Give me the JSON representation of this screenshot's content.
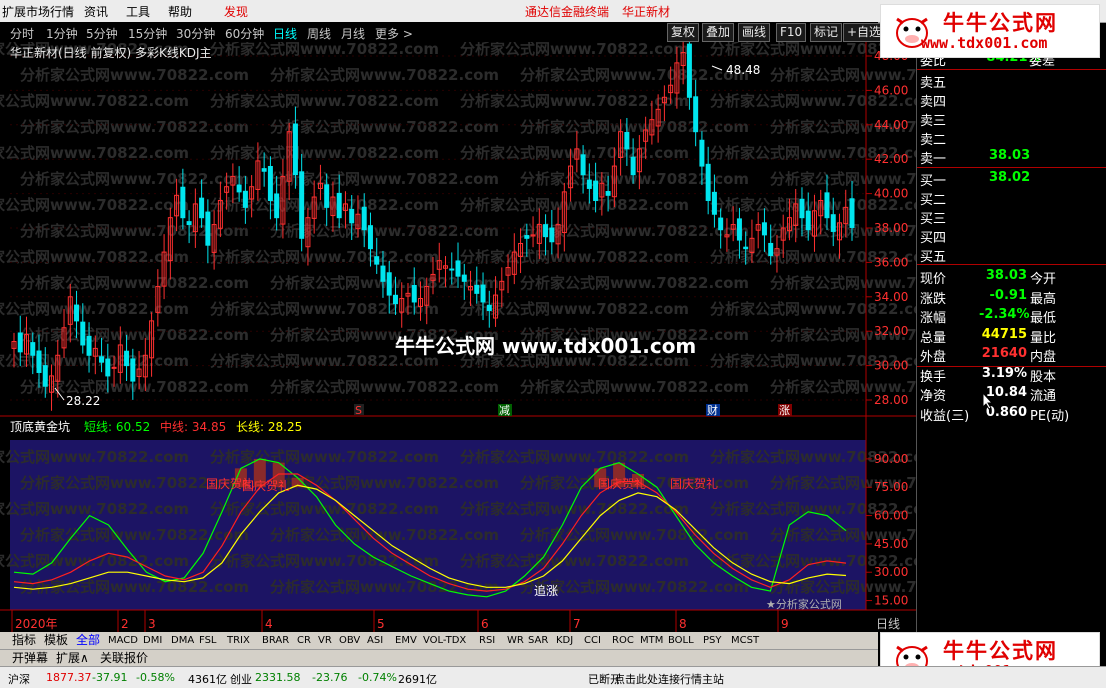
{
  "menu": {
    "items": [
      {
        "label": "扩展市场行情",
        "red": false
      },
      {
        "label": "资讯",
        "red": false
      },
      {
        "label": "工具",
        "red": false
      },
      {
        "label": "帮助",
        "red": false
      },
      {
        "label": "发现",
        "red": true
      }
    ],
    "center_title": "通达信金融终端",
    "center_stock": "华正新材"
  },
  "periods": [
    "分时",
    "1分钟",
    "5分钟",
    "15分钟",
    "30分钟",
    "60分钟",
    "日线",
    "周线",
    "月线",
    "更多 >"
  ],
  "active_period": "日线",
  "toolbar": [
    "复权",
    "叠加",
    "画线",
    "F10",
    "标记",
    "+自选"
  ],
  "chart_title": "华正新材(日线 前复权) 多彩K线KDJ主",
  "price_axis": [
    "48.00",
    "46.00",
    "44.00",
    "42.00",
    "40.00",
    "38.00",
    "36.00",
    "34.00",
    "32.00",
    "30.00",
    "28.00"
  ],
  "price_high_label": "48.48",
  "price_low_label": "28.22",
  "event_markers": [
    "S",
    "减",
    "财",
    "涨"
  ],
  "indicator": {
    "name": "顶底黄金坑",
    "short_label": "短线: 60.52",
    "mid_label": "中线: 34.85",
    "long_label": "长线: 28.25",
    "axis": [
      "90.00",
      "75.00",
      "60.00",
      "45.00",
      "30.00",
      "15.00"
    ],
    "annotations": [
      "国庆贺礼",
      "国庆贺礼",
      "国庆贺礼",
      "国庆贺礼"
    ],
    "signals": [
      "追涨"
    ],
    "watermark": "★分析家公式网"
  },
  "date_axis": [
    "2020年",
    "2",
    "3",
    "4",
    "5",
    "6",
    "7",
    "8",
    "9"
  ],
  "date_axis_end": "日线",
  "tabs": [
    "指标",
    "模板",
    "全部",
    "MACD",
    "DMI",
    "DMA",
    "FSL",
    "TRIX",
    "BRAR",
    "CR",
    "VR",
    "OBV",
    "ASI",
    "EMV",
    "VOL-TDX",
    "RSI",
    "WR",
    "SAR",
    "KDJ",
    "CCI",
    "ROC",
    "MTM",
    "BOLL",
    "PSY",
    "MCST"
  ],
  "active_tab": "全部",
  "tabs2": [
    "开弹幕",
    "扩展∧",
    "关联报价"
  ],
  "quote": {
    "weibi_label": "委比",
    "weibi_value": "-84.21%",
    "weicha_label": "委差",
    "sell": [
      "卖五",
      "卖四",
      "卖三",
      "卖二",
      "卖一"
    ],
    "sell1_price": "38.03",
    "buy": [
      "买一",
      "买二",
      "买三",
      "买四",
      "买五"
    ],
    "buy1_price": "38.02",
    "rows": [
      {
        "l": "现价",
        "v": "38.03",
        "c": "#00ff00",
        "r": "今开"
      },
      {
        "l": "涨跌",
        "v": "-0.91",
        "c": "#00ff00",
        "r": "最高"
      },
      {
        "l": "涨幅",
        "v": "-2.34%",
        "c": "#00ff00",
        "r": "最低"
      },
      {
        "l": "总量",
        "v": "44715",
        "c": "#ffff00",
        "r": "量比"
      },
      {
        "l": "外盘",
        "v": "21640",
        "c": "#ff3030",
        "r": "内盘"
      },
      {
        "l": "换手",
        "v": "3.19%",
        "c": "#ffffff",
        "r": "股本"
      },
      {
        "l": "净资",
        "v": "10.84",
        "c": "#ffffff",
        "r": "流通"
      },
      {
        "l": "收益(三)",
        "v": "0.860",
        "c": "#ffffff",
        "r": "PE(动)"
      }
    ]
  },
  "status": [
    {
      "t": "沪深",
      "c": "#000"
    },
    {
      "t": "1877.37",
      "c": "#e00000"
    },
    {
      "t": "-37.91",
      "c": "#008000"
    },
    {
      "t": "-0.58%",
      "c": "#008000"
    },
    {
      "t": "4361亿",
      "c": "#000"
    },
    {
      "t": "创业",
      "c": "#000"
    },
    {
      "t": "2331.58",
      "c": "#008000"
    },
    {
      "t": "-23.76",
      "c": "#008000"
    },
    {
      "t": "-0.74%",
      "c": "#008000"
    },
    {
      "t": "2691亿",
      "c": "#000"
    },
    {
      "t": "已断开",
      "c": "#000"
    },
    {
      "t": "点击此处连接行情主站",
      "c": "#000"
    }
  ],
  "logo_title": "牛牛公式网",
  "logo_url": "www.tdx001.com",
  "center_ad": "牛牛公式网 www.tdx001.com",
  "watermark_text": "分析家公式网www.70822.com",
  "colors": {
    "up": "#ff3030",
    "down": "#00e5ee",
    "short": "#00ff00",
    "mid": "#ff2020",
    "long": "#ffff00",
    "bg_indicator": "#1c1464"
  },
  "chart_data": [
    {
      "type": "candlestick",
      "title": "华正新材(日线 前复权) 多彩K线KDJ主",
      "ylim": [
        27,
        49
      ],
      "x_ticks": [
        "2020年",
        "2",
        "3",
        "4",
        "5",
        "6",
        "7",
        "8",
        "9"
      ],
      "close": [
        31.4,
        30.8,
        31.8,
        30.6,
        29.6,
        28.8,
        29.4,
        30.6,
        32.2,
        34.0,
        32.6,
        31.2,
        30.6,
        31.0,
        30.2,
        29.4,
        29.9,
        31.2,
        30.0,
        29.1,
        29.8,
        30.6,
        32.6,
        34.6,
        36.6,
        38.6,
        39.9,
        38.6,
        38.2,
        39.4,
        38.6,
        37.0,
        38.2,
        39.6,
        40.4,
        41.0,
        40.1,
        39.2,
        40.4,
        41.9,
        41.3,
        39.6,
        38.6,
        41.0,
        43.6,
        41.1,
        37.4,
        38.6,
        39.8,
        40.6,
        39.2,
        39.8,
        38.6,
        39.4,
        38.3,
        38.8,
        37.9,
        36.8,
        35.9,
        34.9,
        34.1,
        33.6,
        33.9,
        34.2,
        33.7,
        33.9,
        34.6,
        35.3,
        36.1,
        35.8,
        35.6,
        35.2,
        34.9,
        34.6,
        34.2,
        33.7,
        33.2,
        34.1,
        34.9,
        35.7,
        36.6,
        37.1,
        37.4,
        37.6,
        38.2,
        37.5,
        37.2,
        38.2,
        40.1,
        41.6,
        42.6,
        41.1,
        40.3,
        39.6,
        40.6,
        39.9,
        41.6,
        43.6,
        42.6,
        41.1,
        42.6,
        43.7,
        44.3,
        44.9,
        45.6,
        46.3,
        47.6,
        48.2,
        45.6,
        43.6,
        41.6,
        39.6,
        38.8,
        37.9,
        37.6,
        38.2,
        37.3,
        36.8,
        37.4,
        38.2,
        37.6,
        36.4,
        36.8,
        38.0,
        38.6,
        39.4,
        38.6,
        37.9,
        39.0,
        39.6,
        38.6,
        37.8,
        38.3,
        39.2,
        38.03
      ]
    },
    {
      "type": "line",
      "title": "顶底黄金坑",
      "ylim": [
        10,
        100
      ],
      "series": [
        {
          "name": "短线",
          "values": [
            30,
            29,
            35,
            48,
            60,
            55,
            42,
            30,
            25,
            27,
            40,
            62,
            85,
            90,
            88,
            80,
            70,
            55,
            45,
            38,
            33,
            28,
            24,
            20,
            18,
            17,
            20,
            28,
            38,
            55,
            75,
            85,
            88,
            82,
            75,
            60,
            45,
            35,
            28,
            22,
            20,
            55,
            62,
            60,
            52
          ]
        },
        {
          "name": "中线",
          "values": [
            25,
            24,
            26,
            30,
            36,
            40,
            38,
            33,
            28,
            26,
            30,
            44,
            62,
            75,
            82,
            82,
            76,
            68,
            58,
            48,
            40,
            34,
            28,
            24,
            21,
            20,
            21,
            25,
            32,
            45,
            60,
            72,
            78,
            78,
            72,
            62,
            50,
            40,
            32,
            26,
            22,
            26,
            34,
            36,
            34.85
          ]
        },
        {
          "name": "长线",
          "values": [
            22,
            21,
            22,
            24,
            27,
            30,
            30,
            28,
            26,
            25,
            27,
            35,
            50,
            62,
            72,
            76,
            74,
            68,
            60,
            52,
            44,
            38,
            32,
            27,
            24,
            22,
            22,
            24,
            28,
            36,
            48,
            60,
            68,
            72,
            70,
            63,
            53,
            43,
            35,
            29,
            25,
            24,
            27,
            29,
            28.25
          ]
        }
      ]
    }
  ]
}
